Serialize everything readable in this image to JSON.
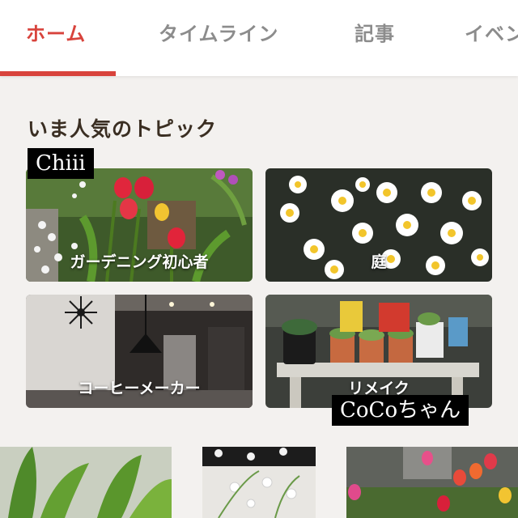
{
  "tabs": [
    {
      "label": "ホーム",
      "active": true
    },
    {
      "label": "タイムライン",
      "active": false
    },
    {
      "label": "記事",
      "active": false
    },
    {
      "label": "イベン",
      "active": false
    }
  ],
  "section": {
    "title": "いま人気のトピック",
    "topics": [
      {
        "label": "ガーデニング初心者"
      },
      {
        "label": "庭"
      },
      {
        "label": "コーヒーメーカー"
      },
      {
        "label": "リメイク"
      }
    ]
  },
  "watermarks": {
    "top": "Chiii",
    "bottom": "CoCoちゃん"
  },
  "colors": {
    "accent": "#d8433c",
    "tab_inactive": "#8c8c8c",
    "title": "#3a2e22",
    "background": "#f3f1ef"
  }
}
